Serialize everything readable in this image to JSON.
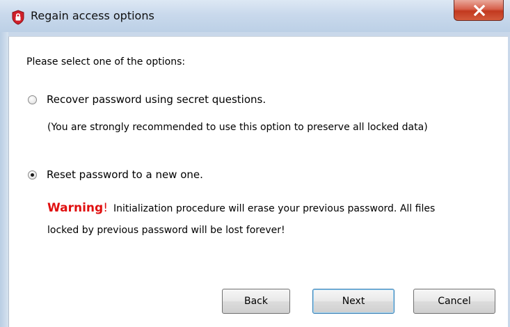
{
  "window": {
    "title": "Regain access options",
    "app_icon": "red-shield-lock-icon",
    "close_icon": "close-icon"
  },
  "content": {
    "prompt": "Please select one of the options:",
    "options": [
      {
        "label": "Recover password using secret questions.",
        "selected": false
      },
      {
        "label": "Reset password to a new one.",
        "selected": true
      }
    ],
    "recommendation_note": "(You are strongly recommended to use this option to preserve all locked data)",
    "warning_label": "Warning",
    "warning_bang": "!",
    "warning_line1": "Initialization procedure will erase your previous password. All files",
    "warning_line2": "locked by previous password will be lost forever!"
  },
  "buttons": {
    "back": "Back",
    "next": "Next",
    "cancel": "Cancel"
  },
  "colors": {
    "warning": "#e01010",
    "close_button": "#c2391f",
    "titlebar": "#c9d9ec"
  }
}
